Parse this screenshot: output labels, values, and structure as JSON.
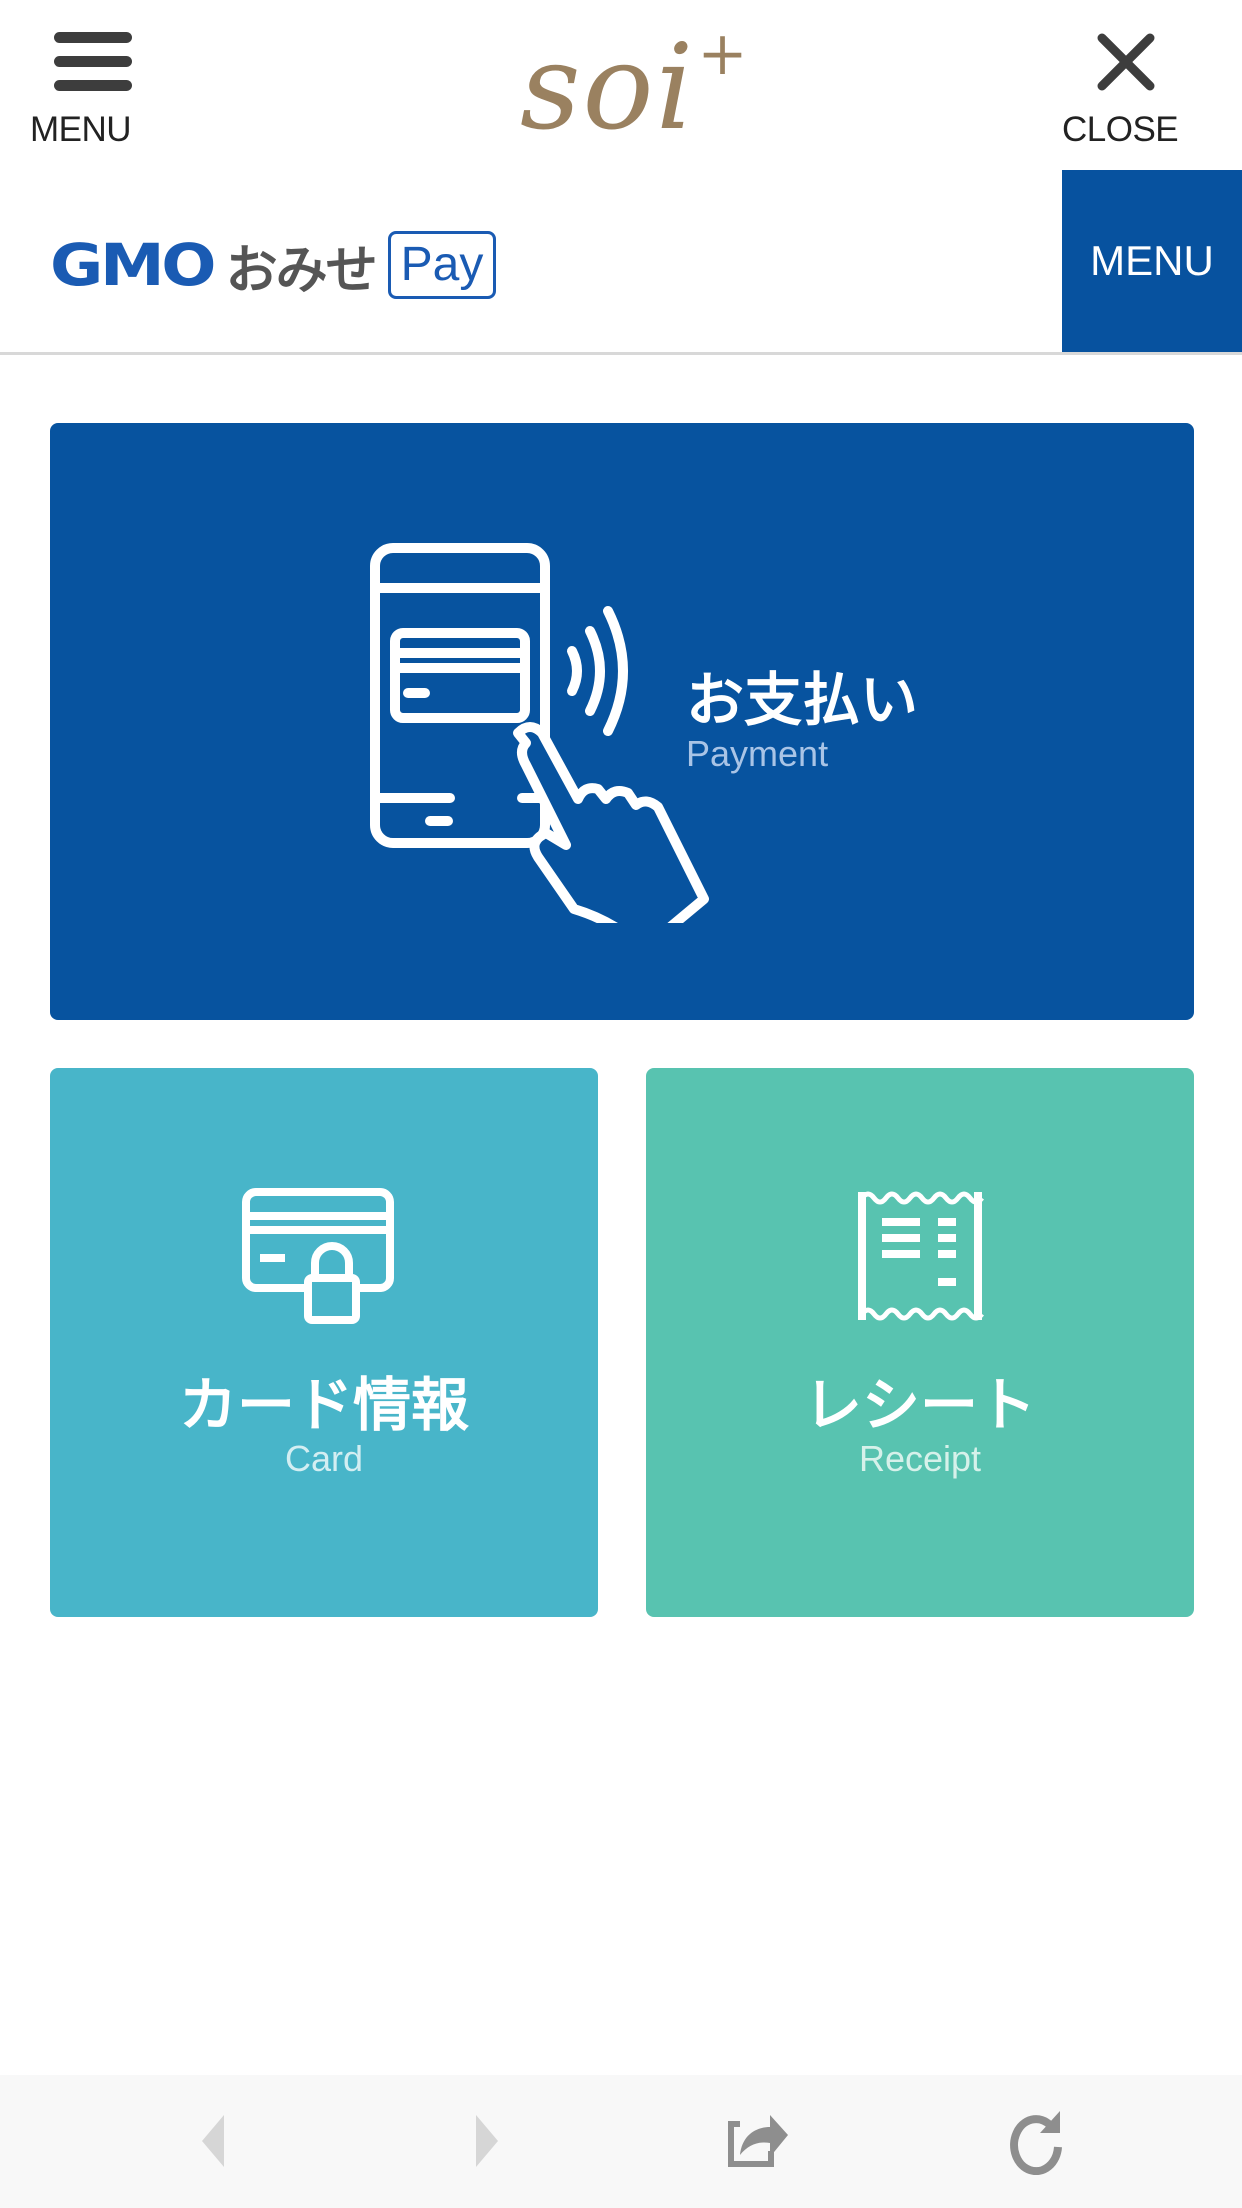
{
  "top_header": {
    "menu_label": "MENU",
    "close_label": "CLOSE",
    "brand_name": "soi",
    "brand_suffix": "+",
    "icons": {
      "menu": "hamburger-icon",
      "close": "close-icon"
    }
  },
  "sub_header": {
    "logo_gmo": "GMO",
    "logo_omise": "おみせ",
    "logo_pay": "Pay",
    "menu_button": "MENU"
  },
  "tiles": [
    {
      "id": "payment",
      "title": "お支払い",
      "subtitle": "Payment",
      "icon": "phone-tap-payment-icon",
      "color": "#07539f"
    },
    {
      "id": "card",
      "title": "カード情報",
      "subtitle": "Card",
      "icon": "card-lock-icon",
      "color": "#48b5c9"
    },
    {
      "id": "receipt",
      "title": "レシート",
      "subtitle": "Receipt",
      "icon": "receipt-icon",
      "color": "#58c3b0"
    }
  ],
  "browser_bar": {
    "buttons": [
      {
        "name": "back",
        "icon": "back-arrow-icon",
        "enabled": false
      },
      {
        "name": "forward",
        "icon": "forward-arrow-icon",
        "enabled": false
      },
      {
        "name": "share",
        "icon": "share-icon",
        "enabled": true
      },
      {
        "name": "reload",
        "icon": "reload-icon",
        "enabled": true
      }
    ]
  },
  "colors": {
    "brand_blue": "#07529f",
    "gmo_blue": "#1a5bb3",
    "card_tile": "#48b5c9",
    "receipt_tile": "#58c3b0",
    "soi_gold": "#9a8160"
  }
}
